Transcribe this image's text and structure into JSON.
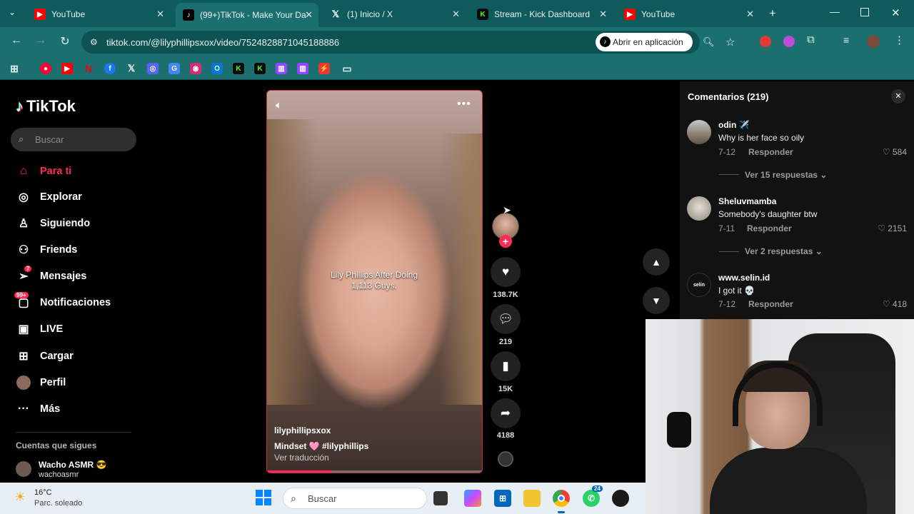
{
  "browser": {
    "tabs": [
      {
        "label": "YouTube",
        "icon": "youtube-icon",
        "color": "#ff0000"
      },
      {
        "label": "(99+)TikTok - Make Your Da",
        "icon": "tiktok-icon",
        "color": "#000000"
      },
      {
        "label": "(1) Inicio / X",
        "icon": "x-icon",
        "color": "#000000"
      },
      {
        "label": "Stream - Kick Dashboard",
        "icon": "kick-icon",
        "color": "#53fc18"
      },
      {
        "label": "YouTube",
        "icon": "youtube-icon",
        "color": "#ff0000"
      }
    ],
    "url": "tiktok.com/@lilyphillipsxox/video/7524828871045188886",
    "open_app_label": "Abrir en aplicación",
    "theme_color": "#1c6f6f"
  },
  "sidebar": {
    "logo": "TikTok",
    "search_placeholder": "Buscar",
    "items": [
      {
        "label": "Para ti",
        "icon": "home-icon"
      },
      {
        "label": "Explorar",
        "icon": "compass-icon"
      },
      {
        "label": "Siguiendo",
        "icon": "following-icon"
      },
      {
        "label": "Friends",
        "icon": "friends-icon"
      },
      {
        "label": "Mensajes",
        "icon": "messages-icon",
        "badge": "7"
      },
      {
        "label": "Notificaciones",
        "icon": "notifications-icon",
        "badge": "99+"
      },
      {
        "label": "LIVE",
        "icon": "live-icon"
      },
      {
        "label": "Cargar",
        "icon": "upload-icon"
      },
      {
        "label": "Perfil",
        "icon": "profile-icon"
      },
      {
        "label": "Más",
        "icon": "more-icon"
      }
    ],
    "following_heading": "Cuentas que sigues",
    "following": [
      {
        "name": "Wacho ASMR 😎",
        "handle": "wachoasmr"
      }
    ]
  },
  "video": {
    "caption_overlay": "Lily Phillips After Doing 1,113 Guys.",
    "author": "lilyphillipsxox",
    "description": "Mindset 🩷 #lilyphillips",
    "translate": "Ver traducción",
    "progress_fraction": 0.3,
    "likes": "138.7K",
    "comments": "219",
    "saves": "15K",
    "shares": "4188"
  },
  "comments_panel": {
    "title": "Comentarios (219)",
    "reply_label": "Responder",
    "items": [
      {
        "user": "odin ✈️",
        "text": "Why is her face so oily",
        "date": "7-12",
        "likes": "584",
        "more": "Ver 15 respuestas"
      },
      {
        "user": "Sheluvmamba",
        "text": "Somebody's daughter btw",
        "date": "7-11",
        "likes": "2151",
        "more": "Ver 2 respuestas"
      },
      {
        "user": "www.selin.id",
        "text": "I got it 💀",
        "date": "7-12",
        "likes": "418",
        "more": ""
      }
    ]
  },
  "taskbar": {
    "temp": "16°C",
    "weather": "Parc. soleado",
    "search_placeholder": "Buscar",
    "whatsapp_badge": "24"
  }
}
